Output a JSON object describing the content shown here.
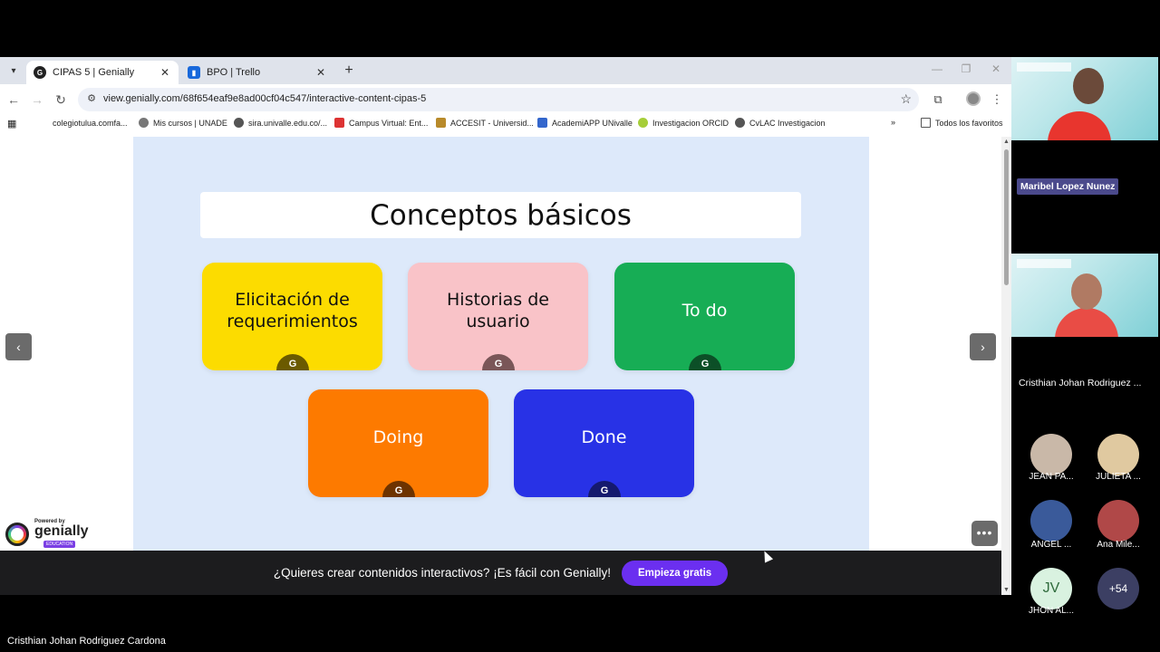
{
  "browser": {
    "tabs": [
      {
        "title": "CIPAS 5 | Genially",
        "active": true,
        "favicon_color": "#222222"
      },
      {
        "title": "BPO | Trello",
        "active": false,
        "favicon_color": "#1868db"
      }
    ],
    "url": "view.genially.com/68f654eaf9e8ad00cf04c547/interactive-content-cipas-5",
    "bookmarks": [
      {
        "label": "colegiotulua.comfa...",
        "color": "#3a7"
      },
      {
        "label": "Mis cursos | UNADE",
        "color": "#666"
      },
      {
        "label": "sira.univalle.edu.co/...",
        "color": "#555"
      },
      {
        "label": "Campus Virtual: Ent...",
        "color": "#d33"
      },
      {
        "label": "ACCESIT - Universid...",
        "color": "#b88a2a"
      },
      {
        "label": "AcademiAPP UNivalle",
        "color": "#36c"
      },
      {
        "label": "Investigacion ORCID",
        "color": "#a6ce39"
      },
      {
        "label": "CvLAC Investigacion",
        "color": "#555"
      }
    ],
    "all_bookmarks_label": "Todos los favoritos"
  },
  "slide": {
    "title": "Conceptos básicos",
    "background": "#dde9fa",
    "cards": [
      {
        "label": "Elicitación de requerimientos",
        "bg": "#fcdc00",
        "fg": "#111111",
        "badge": "#6b5a00"
      },
      {
        "label": "Historias de usuario",
        "bg": "#f9c3c8",
        "fg": "#111111",
        "badge": "#7a5658"
      },
      {
        "label": "To do",
        "bg": "#17ad55",
        "fg": "#ffffff",
        "badge": "#0c4f27"
      },
      {
        "label": "Doing",
        "bg": "#fd7a00",
        "fg": "#ffffff",
        "badge": "#6e3300"
      },
      {
        "label": "Done",
        "bg": "#2832e6",
        "fg": "#ffffff",
        "badge": "#151a6e"
      }
    ],
    "badge_glyph": "G",
    "prev_icon": "‹",
    "next_icon": "›",
    "more_icon": "•••"
  },
  "powered_by": {
    "small": "Powered by",
    "brand": "genially",
    "tag": "EDUCATION"
  },
  "promo": {
    "text": "¿Quieres crear contenidos interactivos? ¡Es fácil con Genially!",
    "button": "Empieza gratis"
  },
  "participants": {
    "video1_name": "Maribel  Lopez Nunez",
    "video2_name": "Cristhian Johan Rodriguez ...",
    "people": [
      {
        "label": "JEAN PA...",
        "initials": "",
        "bg": "#c9b8a8"
      },
      {
        "label": "JULIETA ...",
        "initials": "",
        "bg": "#e0c9a0"
      },
      {
        "label": "ANGEL ...",
        "initials": "",
        "bg": "#3a5a9a"
      },
      {
        "label": "Ana Mile...",
        "initials": "",
        "bg": "#b04848"
      },
      {
        "label": "JHON AL...",
        "initials": "JV",
        "bg": "#d9f2e0"
      },
      {
        "label": "",
        "initials": "+54",
        "bg": "#3c3f63"
      }
    ]
  },
  "presenter_name": "Cristhian Johan Rodriguez Cardona"
}
